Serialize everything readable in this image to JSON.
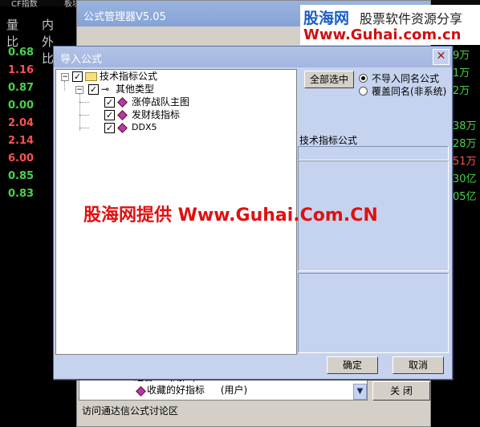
{
  "background": {
    "top_strip": [
      "CF指数",
      "板块"
    ],
    "headers": [
      "量比",
      "内外比"
    ],
    "left_values": [
      {
        "text": "0.68",
        "color": "#4bd24b"
      },
      {
        "text": "1.16",
        "color": "#ff5050"
      },
      {
        "text": "0.87",
        "color": "#4bd24b"
      },
      {
        "text": "0.00",
        "color": "#4bd24b"
      },
      {
        "text": "2.04",
        "color": "#ff5050"
      },
      {
        "text": "2.14",
        "color": "#ff5050"
      },
      {
        "text": "6.00",
        "color": "#ff5050"
      },
      {
        "text": "0.85",
        "color": "#4bd24b"
      },
      {
        "text": "0.83",
        "color": "#4bd24b"
      }
    ],
    "right_values": [
      {
        "text": "9万",
        "color": "#4bd24b"
      },
      {
        "text": "1万",
        "color": "#4bd24b"
      },
      {
        "text": "2万",
        "color": "#4bd24b"
      },
      {
        "text": "",
        "color": "#4bd24b"
      },
      {
        "text": "38万",
        "color": "#4bd24b"
      },
      {
        "text": "28万",
        "color": "#4bd24b"
      },
      {
        "text": "51万",
        "color": "#ff5050"
      },
      {
        "text": "30亿",
        "color": "#4bd24b"
      },
      {
        "text": "05亿",
        "color": "#4bd24b"
      }
    ]
  },
  "logo": {
    "site_name": "股海网",
    "slogan": "股票软件资源分享",
    "url": "Www.Guhai.com.cn"
  },
  "manager": {
    "title": "公式管理器V5.05",
    "list_rows": [
      {
        "text": "组合",
        "suffix": "(用户)"
      },
      {
        "text": "收藏的好指标",
        "suffix": "(用户)"
      }
    ],
    "close_button": "关  闭",
    "footer_link": "访问通达信公式讨论区"
  },
  "dialog": {
    "title": "导入公式",
    "close_glyph": "✕",
    "tree": {
      "root_label": "技术指标公式",
      "group_label": "其他类型",
      "items": [
        "涨停战队主图",
        "发财线指标",
        "DDX5"
      ]
    },
    "select_all_button": "全部选中",
    "radio_options": [
      {
        "label": "不导入同名公式",
        "selected": true
      },
      {
        "label": "覆盖同名(非系统)",
        "selected": false
      }
    ],
    "info_label": "技术指标公式",
    "ok_button": "确定",
    "cancel_button": "取消"
  },
  "watermark": "股海网提供 Www.Guhai.Com.CN"
}
